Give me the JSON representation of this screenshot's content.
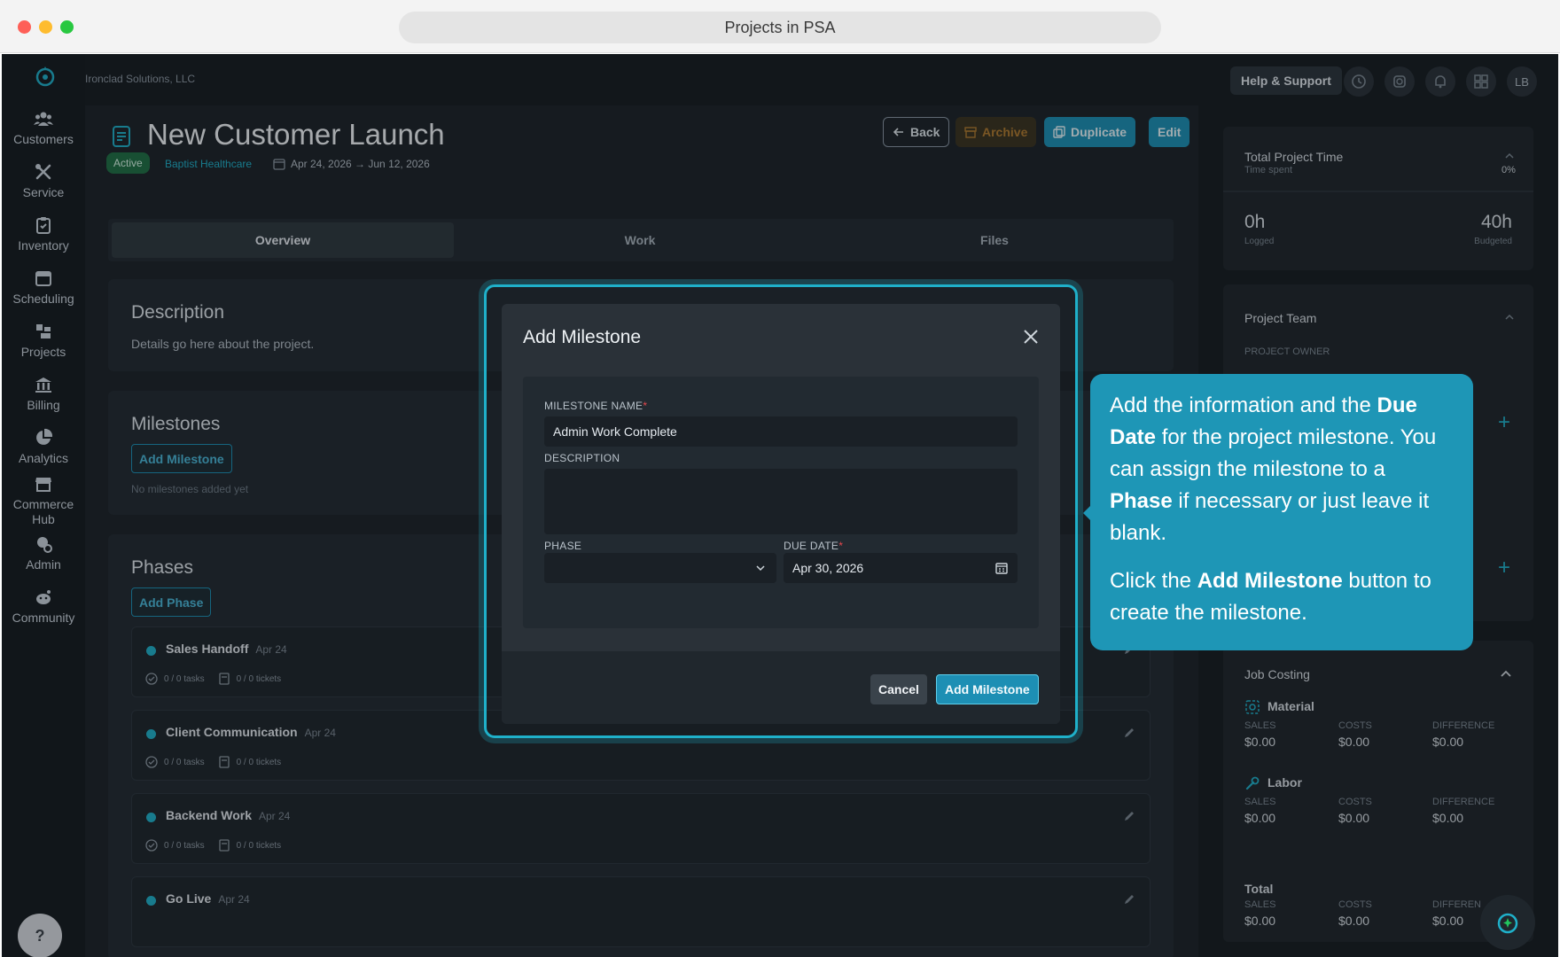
{
  "window": {
    "title": "Projects in PSA"
  },
  "org": {
    "name": "Ironclad Solutions, LLC"
  },
  "sidebar": {
    "items": [
      {
        "label": "Customers",
        "icon": "users-icon"
      },
      {
        "label": "Service",
        "icon": "tools-icon"
      },
      {
        "label": "Inventory",
        "icon": "clipboard-icon"
      },
      {
        "label": "Scheduling",
        "icon": "calendar-icon"
      },
      {
        "label": "Projects",
        "icon": "projects-icon"
      },
      {
        "label": "Billing",
        "icon": "bank-icon"
      },
      {
        "label": "Analytics",
        "icon": "pie-chart-icon"
      },
      {
        "label": "Commerce\nHub",
        "icon": "store-icon"
      },
      {
        "label": "Admin",
        "icon": "admin-icon"
      },
      {
        "label": "Community",
        "icon": "community-icon"
      }
    ],
    "help_label": "?"
  },
  "topbar": {
    "help_support": "Help & Support",
    "avatar_initials": "LB"
  },
  "project": {
    "title": "New Customer Launch",
    "status": "Active",
    "customer": "Baptist Healthcare",
    "date_range": "Apr 24, 2026 → Jun 12, 2026",
    "actions": {
      "back": "Back",
      "archive": "Archive",
      "duplicate": "Duplicate",
      "edit": "Edit"
    }
  },
  "tabs": [
    "Overview",
    "Work",
    "Files"
  ],
  "description": {
    "heading": "Description",
    "text": "Details go here about the project."
  },
  "milestones": {
    "heading": "Milestones",
    "add_label": "Add Milestone",
    "empty_text": "No milestones added yet"
  },
  "phases": {
    "heading": "Phases",
    "add_label": "Add Phase",
    "items": [
      {
        "name": "Sales Handoff",
        "date": "Apr 24",
        "tasks": "0 / 0 tasks",
        "tickets": "0 / 0 tickets"
      },
      {
        "name": "Client Communication",
        "date": "Apr 24",
        "tasks": "0 / 0 tasks",
        "tickets": "0 / 0 tickets"
      },
      {
        "name": "Backend Work",
        "date": "Apr 24",
        "tasks": "0 / 0 tasks",
        "tickets": "0 / 0 tickets"
      },
      {
        "name": "Go Live",
        "date": "Apr 24",
        "tasks": "",
        "tickets": ""
      }
    ]
  },
  "right": {
    "time": {
      "title": "Total Project Time",
      "subtitle": "Time spent",
      "percent": "0%",
      "logged_value": "0h",
      "logged_label": "Logged",
      "budget_value": "40h",
      "budget_label": "Budgeted"
    },
    "team": {
      "title": "Project Team",
      "owner_label": "PROJECT OWNER"
    },
    "job_costing": {
      "title": "Job Costing",
      "sections": [
        {
          "name": "Material",
          "sales": "$0.00",
          "costs": "$0.00",
          "difference": "$0.00"
        },
        {
          "name": "Labor",
          "sales": "$0.00",
          "costs": "$0.00",
          "difference": "$0.00"
        },
        {
          "name": "Total",
          "sales": "$0.00",
          "costs": "$0.00",
          "difference": "$0.00"
        }
      ],
      "col_sales": "SALES",
      "col_costs": "COSTS",
      "col_difference": "DIFFERENCE",
      "col_difference_cut": "DIFFEREN"
    }
  },
  "modal": {
    "title": "Add Milestone",
    "name_label": "MILESTONE NAME",
    "name_value": "Admin Work Complete",
    "description_label": "DESCRIPTION",
    "description_value": "",
    "phase_label": "PHASE",
    "phase_value": "",
    "due_label": "DUE DATE",
    "due_value": "Apr 30, 2026",
    "required_mark": "*",
    "cancel": "Cancel",
    "submit": "Add Milestone"
  },
  "tooltip": {
    "p1_a": "Add the information and the ",
    "p1_b": "Due Date",
    "p1_c": " for the project milestone. You can assign the milestone to a ",
    "p1_d": "Phase",
    "p1_e": " if necessary or just leave it blank.",
    "p2_a": "Click the ",
    "p2_b": "Add Milestone",
    "p2_c": " button to create the milestone."
  },
  "colors": {
    "accent": "#1d8fb4",
    "tooltip": "#1e96b6",
    "active_badge": "#1f6f45",
    "archive": "#b07a2e"
  }
}
